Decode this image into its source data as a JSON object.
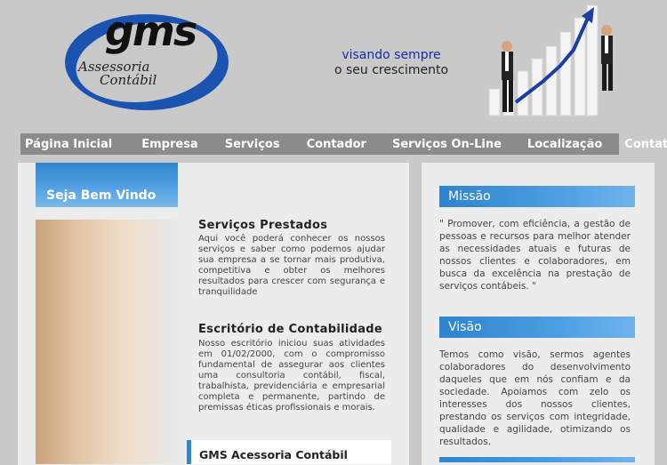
{
  "header": {
    "logo": {
      "brand": "gms",
      "sub1": "Assessoria",
      "sub2": "Contábil"
    },
    "tagline_line1": "visando sempre",
    "tagline_line2": "o seu crescimento"
  },
  "nav": {
    "items": [
      {
        "label": "Página Inicial"
      },
      {
        "label": "Empresa"
      },
      {
        "label": "Serviços"
      },
      {
        "label": "Contador"
      },
      {
        "label": "Serviços On-Line"
      },
      {
        "label": "Localização"
      },
      {
        "label": "Contato"
      }
    ]
  },
  "main": {
    "welcome": "Seja Bem Vindo",
    "sections": [
      {
        "title": "Serviços Prestados",
        "text": "Aqui você poderá conhecer os nossos serviços e saber como podemos ajudar sua empresa a se tornar mais produtiva, competitiva e obter os melhores resultados para crescer com segurança e tranquilidade"
      },
      {
        "title": "Escritório de Contabilidade",
        "text": "Nosso escritório iniciou suas atividades em 01/02/2000, com o compromisso fundamental de assegurar aos clientes uma consultoria contábil, fiscal, trabalhista, previdenciária e empresarial completa e permanente, partindo de premissas éticas profissionais e morais."
      }
    ],
    "gms_box": "GMS Acessoria Contábil"
  },
  "sidebar": {
    "missao_title": "Missão",
    "missao_text": "\" Promover, com eficiência, a gestão de pessoas e recursos para melhor atender as necessidades atuais e futuras de nossos clientes e colaboradores, em busca da excelência na prestação de serviços contábeis. \"",
    "visao_title": "Visão",
    "visao_text": "Temos como visão, sermos agentes colaboradores do desenvolvimento daqueles que em nós confiam e da sociedade. Apoiamos com zelo os interesses dos nossos clientes, prestando os serviços com integridade, qualidade e agilidade, otimizando os resultados."
  },
  "colors": {
    "brand_blue": "#1a4fa8",
    "accent": "#2f86cc",
    "nav_bg": "#8b8b8b"
  },
  "icons": [
    "gms-logo",
    "growth-chart-illustration",
    "businessman-figure"
  ]
}
